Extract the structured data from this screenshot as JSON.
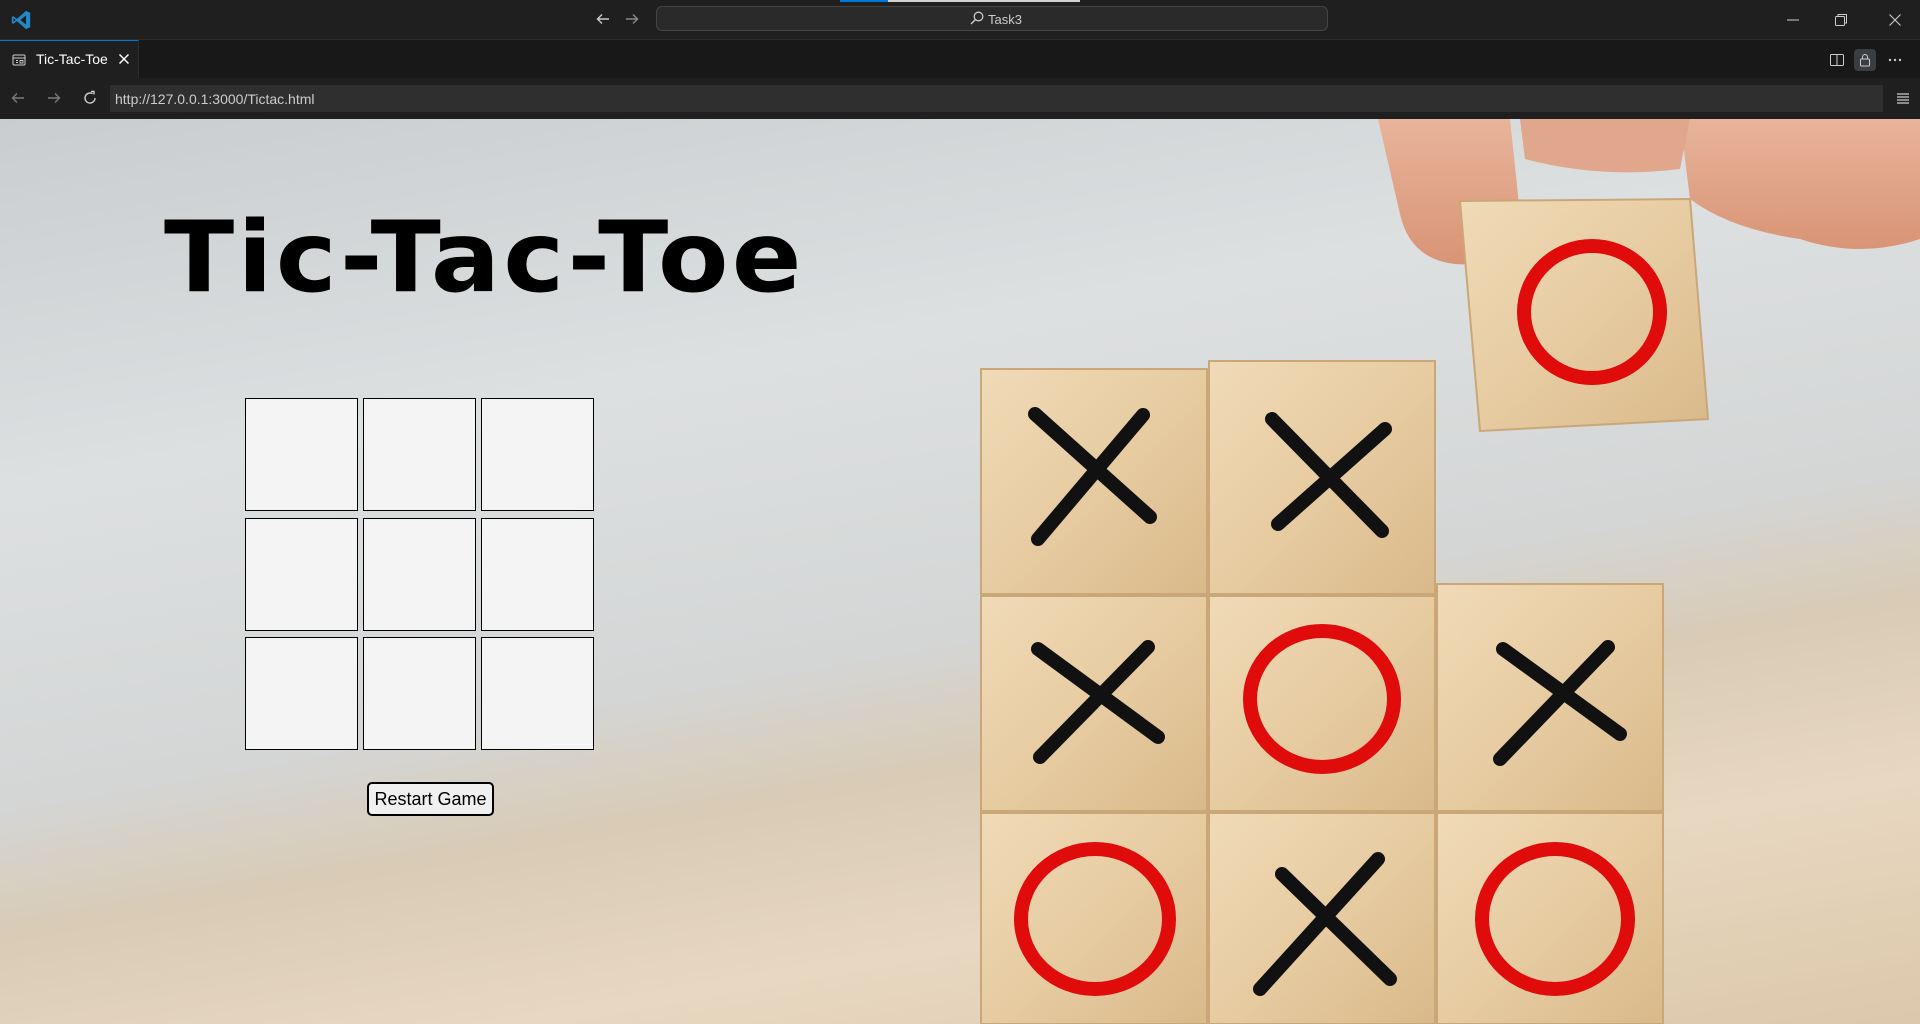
{
  "window": {
    "command_center_text": "Task3"
  },
  "tab": {
    "label": "Tic-Tac-Toe"
  },
  "address_bar": {
    "url": "http://127.0.0.1:3000/Tictac.html"
  },
  "page": {
    "title": "Tic-Tac-Toe",
    "board": {
      "cells": [
        "",
        "",
        "",
        "",
        "",
        "",
        "",
        "",
        ""
      ]
    },
    "restart_label": "Restart Game"
  },
  "colors": {
    "accent": "#0078d4",
    "o_mark": "#e00b0b",
    "x_mark": "#111111",
    "block": "#e9cfa5"
  }
}
